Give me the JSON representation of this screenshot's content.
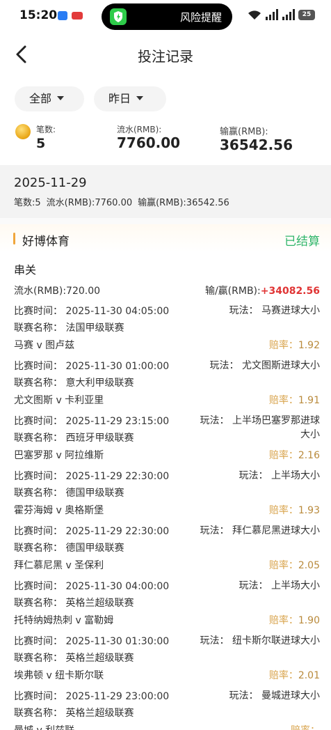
{
  "status_bar": {
    "time": "15:20",
    "notice": "风险提醒",
    "battery": "25"
  },
  "nav": {
    "title": "投注记录"
  },
  "filters": {
    "type": "全部",
    "date": "昨日"
  },
  "summary": {
    "count_label": "笔数:",
    "count_value": "5",
    "turnover_label": "流水(RMB):",
    "turnover_value": "7760.00",
    "winloss_label": "输赢(RMB):",
    "winloss_value": "36542.56"
  },
  "date_group": {
    "date": "2025-11-29",
    "count": "笔数:5",
    "turnover": "流水(RMB):7760.00",
    "winloss": "输赢(RMB):36542.56"
  },
  "card": {
    "vendor": "好博体育",
    "status": "已结算",
    "bet_type": "串关",
    "stake": "流水(RMB):720.00",
    "winloss_label": "输/赢(RMB):",
    "winloss_value": "+34082.56",
    "colors": {
      "accent": "#f0a63c",
      "settled": "#2fb56a",
      "win": "#e03535",
      "odds": "#d9a54f"
    },
    "bets": [
      {
        "time": "比赛时间：  2025-11-30 04:05:00",
        "league": "联赛名称：  法国甲级联赛",
        "match": "马赛 v 图卢兹",
        "play": "玩法：  马赛进球大小",
        "odds_label": "赔率：",
        "odds": "1.92"
      },
      {
        "time": "比赛时间：  2025-11-30 01:00:00",
        "league": "联赛名称：  意大利甲级联赛",
        "match": "尤文图斯 v 卡利亚里",
        "play": "玩法：  尤文图斯进球大小",
        "odds_label": "赔率：",
        "odds": "1.91"
      },
      {
        "time": "比赛时间：  2025-11-29 23:15:00",
        "league": "联赛名称：  西班牙甲级联赛",
        "match": "巴塞罗那 v 阿拉维斯",
        "play": "玩法：  上半场巴塞罗那进球大小",
        "odds_label": "赔率：",
        "odds": "2.16"
      },
      {
        "time": "比赛时间：  2025-11-29 22:30:00",
        "league": "联赛名称：  德国甲级联赛",
        "match": "霍芬海姆 v 奥格斯堡",
        "play": "玩法：  上半场大小",
        "odds_label": "赔率：",
        "odds": "1.93"
      },
      {
        "time": "比赛时间：  2025-11-29 22:30:00",
        "league": "联赛名称：  德国甲级联赛",
        "match": "拜仁慕尼黑 v 圣保利",
        "play": "玩法：  拜仁慕尼黑进球大小",
        "odds_label": "赔率：",
        "odds": "2.05"
      },
      {
        "time": "比赛时间：  2025-11-30 04:00:00",
        "league": "联赛名称：  英格兰超级联赛",
        "match": "托特纳姆热刺 v 富勒姆",
        "play": "玩法：  上半场大小",
        "odds_label": "赔率：",
        "odds": "1.90"
      },
      {
        "time": "比赛时间：  2025-11-30 01:30:00",
        "league": "联赛名称：  英格兰超级联赛",
        "match": "埃弗顿 v 纽卡斯尔联",
        "play": "玩法：  纽卡斯尔联进球大小",
        "odds_label": "赔率：",
        "odds": "2.01"
      },
      {
        "time": "比赛时间：  2025-11-29 23:00:00",
        "league": "联赛名称：  英格兰超级联赛",
        "match": "曼城 v 利兹联",
        "play": "玩法：  曼城进球大小",
        "odds_label": "赔率：",
        "odds": ""
      }
    ]
  }
}
